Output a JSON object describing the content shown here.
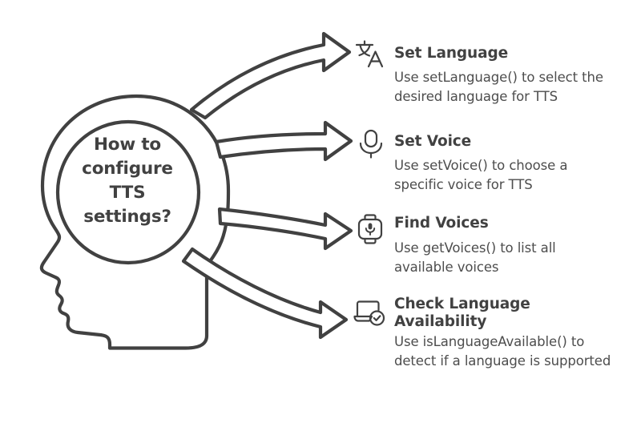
{
  "meta": {
    "background_color": "#ffffff",
    "stroke_color": "#414141",
    "text_color": "#414141",
    "muted_text_color": "#4d4d4d"
  },
  "central": {
    "name": "head-with-brain",
    "question_lines": [
      "How to",
      "configure",
      "TTS",
      "settings?"
    ],
    "question_text": "How to configure TTS settings?"
  },
  "arrows": [
    {
      "name": "arrow-to-set-language",
      "from": "brain",
      "to": "Set Language"
    },
    {
      "name": "arrow-to-set-voice",
      "from": "brain",
      "to": "Set Voice"
    },
    {
      "name": "arrow-to-find-voices",
      "from": "brain",
      "to": "Find Voices"
    },
    {
      "name": "arrow-to-check-language-availability",
      "from": "brain",
      "to": "Check Language Availability"
    }
  ],
  "items": [
    {
      "icon": "translate-icon",
      "title": "Set Language",
      "desc": "Use setLanguage() to select the desired language for TTS"
    },
    {
      "icon": "microphone-icon",
      "title": "Set Voice",
      "desc": "Use setVoice() to choose a specific voice for TTS"
    },
    {
      "icon": "smartwatch-microphone-icon",
      "title": "Find Voices",
      "desc": "Use getVoices() to list all available voices"
    },
    {
      "icon": "laptop-check-icon",
      "title": "Check Language Availability",
      "desc": "Use isLanguageAvailable() to detect if a language is supported"
    }
  ]
}
